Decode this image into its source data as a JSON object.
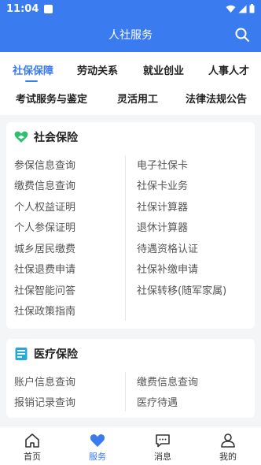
{
  "status": {
    "time": "11:04"
  },
  "header": {
    "title": "人社服务"
  },
  "tabs": {
    "row1": [
      "社保保障",
      "劳动关系",
      "就业创业",
      "人事人才"
    ],
    "row2": [
      "考试服务与鉴定",
      "灵活用工",
      "法律法规公告"
    ]
  },
  "social_insurance": {
    "title": "社会保险",
    "left": [
      "参保信息查询",
      "缴费信息查询",
      "个人权益证明",
      "个人参保证明",
      "城乡居民缴费",
      "社保退费申请",
      "社保智能问答",
      "社保政策指南"
    ],
    "right": [
      "电子社保卡",
      "社保卡业务",
      "社保计算器",
      "退休计算器",
      "待遇资格认证",
      "社保补缴申请",
      "社保转移(随军家属)"
    ]
  },
  "medical_insurance": {
    "title": "医疗保险",
    "left": [
      "账户信息查询",
      "报销记录查询"
    ],
    "right": [
      "缴费信息查询",
      "医疗待遇"
    ]
  },
  "nav": [
    "首页",
    "服务",
    "消息",
    "我的"
  ],
  "colors": {
    "accent": "#3a7bf0",
    "green": "#2fbf71"
  }
}
